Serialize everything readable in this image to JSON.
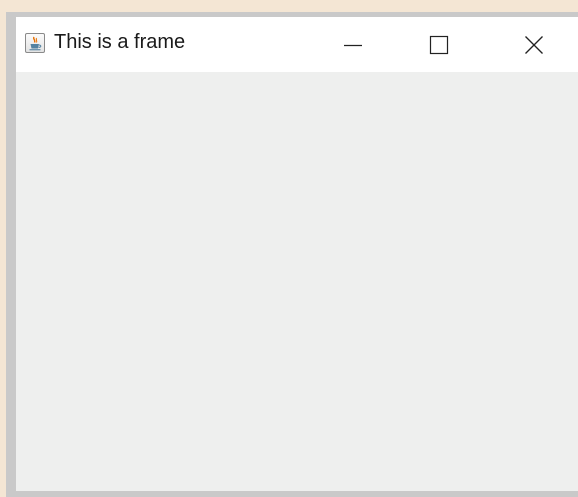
{
  "window": {
    "title": "This is a frame",
    "app_icon": "java-coffee-cup-icon",
    "controls": {
      "minimize_icon": "minimize-icon",
      "maximize_icon": "maximize-icon",
      "close_icon": "close-icon"
    }
  },
  "colors": {
    "desktop": "#f4e6d4",
    "frame_border": "#c9c9c9",
    "titlebar": "#ffffff",
    "client": "#eeefee",
    "java_orange": "#e76f00",
    "java_blue": "#5382a1"
  }
}
